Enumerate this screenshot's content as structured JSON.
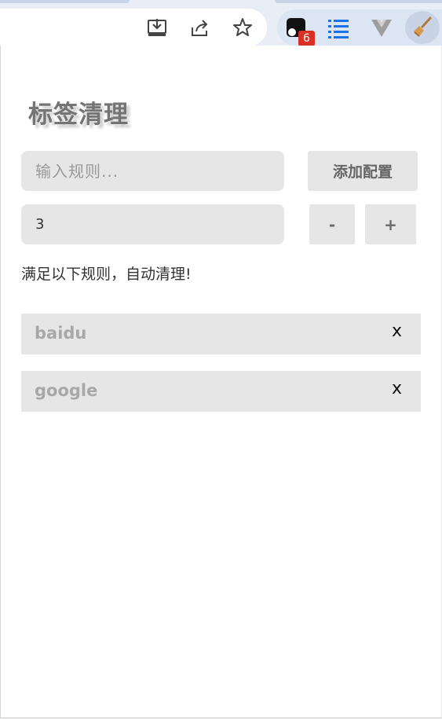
{
  "browser": {
    "toolbar_icons": [
      "install-icon",
      "share-icon",
      "bookmark-star-icon"
    ],
    "extensions": [
      "extension-app-icon",
      "list-icon",
      "vue-icon",
      "broom-icon"
    ],
    "badge_count": "6"
  },
  "popup": {
    "title": "标签清理",
    "rule_input_placeholder": "输入规则...",
    "add_button_label": "添加配置",
    "count_value": "3",
    "minus_label": "-",
    "plus_label": "+",
    "hint": "满足以下规则，自动清理!",
    "rules": [
      {
        "name": "baidu",
        "delete_label": "x"
      },
      {
        "name": "google",
        "delete_label": "x"
      }
    ]
  },
  "colors": {
    "panel_bg": "#e6e6e6",
    "title": "#747474",
    "rule_text": "#a8a8a8",
    "badge": "#d93025"
  }
}
